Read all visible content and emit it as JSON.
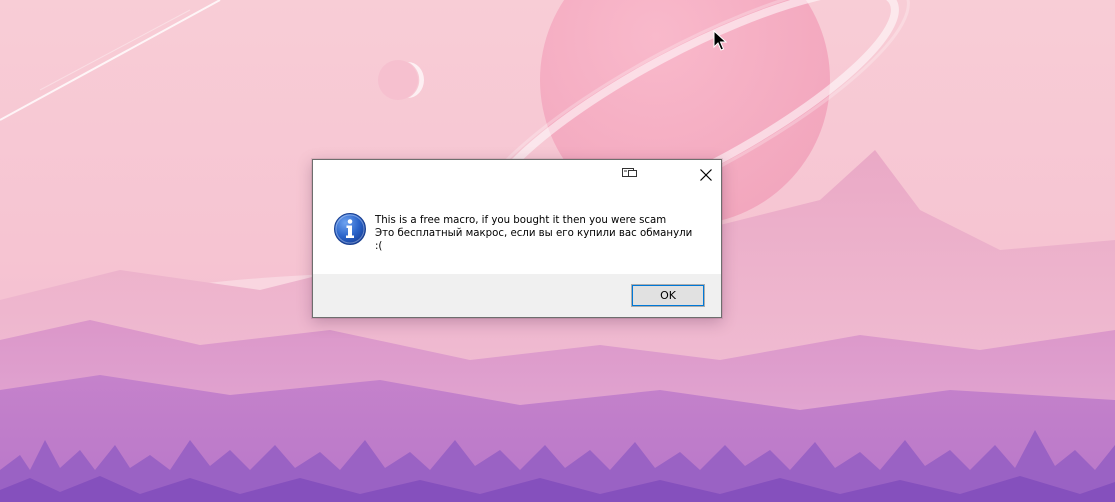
{
  "desktop": {
    "wallpaper": "pink-planet-mountains"
  },
  "dialog": {
    "title": "",
    "message_line1": "This is a free macro, if you bought it then you were scam",
    "message_line2": "Это бесплатный макрос, если вы его купили вас обманули",
    "message_line3": ":(",
    "ok_label": "OK",
    "icon": "info-icon",
    "close_icon": "close-icon",
    "titlebar_icon": "restore-window-icon"
  },
  "colors": {
    "info_icon_blue": "#1f57b8",
    "button_focus": "#0078d7",
    "footer_bg": "#f0f0f0"
  }
}
